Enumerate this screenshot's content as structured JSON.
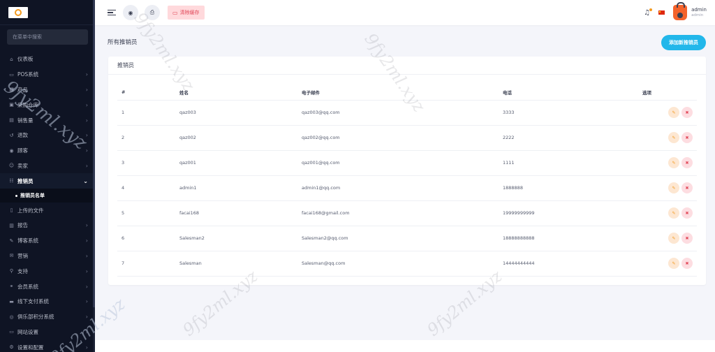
{
  "sidebar": {
    "search_placeholder": "在菜单中搜索",
    "items": [
      {
        "label": "仪表板",
        "icon": "home-icon",
        "glyph": "⌂",
        "chevron": false
      },
      {
        "label": "POS系统",
        "icon": "pos-icon",
        "glyph": "▭",
        "chevron": true
      },
      {
        "label": "产品",
        "icon": "product-icon",
        "glyph": "▦",
        "chevron": true
      },
      {
        "label": "采购仓库",
        "icon": "purchase-icon",
        "glyph": "▣",
        "chevron": true
      },
      {
        "label": "销售量",
        "icon": "sales-icon",
        "glyph": "▤",
        "chevron": true
      },
      {
        "label": "退款",
        "icon": "refund-icon",
        "glyph": "↺",
        "chevron": true
      },
      {
        "label": "顾客",
        "icon": "customer-icon",
        "glyph": "◉",
        "chevron": true
      },
      {
        "label": "卖家",
        "icon": "seller-icon",
        "glyph": "☺",
        "chevron": true
      },
      {
        "label": "推销员",
        "icon": "salesman-icon",
        "glyph": "☷",
        "chevron": true,
        "active": true
      },
      {
        "label": "上传的文件",
        "icon": "file-icon",
        "glyph": "▯",
        "chevron": false
      },
      {
        "label": "报告",
        "icon": "report-icon",
        "glyph": "▥",
        "chevron": true
      },
      {
        "label": "博客系统",
        "icon": "blog-icon",
        "glyph": "✎",
        "chevron": true
      },
      {
        "label": "营销",
        "icon": "marketing-icon",
        "glyph": "✉",
        "chevron": true
      },
      {
        "label": "支持",
        "icon": "support-icon",
        "glyph": "⚲",
        "chevron": true
      },
      {
        "label": "会员系统",
        "icon": "member-icon",
        "glyph": "⚭",
        "chevron": true
      },
      {
        "label": "线下支付系统",
        "icon": "offline-pay-icon",
        "glyph": "▬",
        "chevron": true
      },
      {
        "label": "俱乐部积分系统",
        "icon": "club-point-icon",
        "glyph": "◎",
        "chevron": true
      },
      {
        "label": "网站设置",
        "icon": "website-icon",
        "glyph": "▭",
        "chevron": true
      },
      {
        "label": "设置和配置",
        "icon": "settings-icon",
        "glyph": "⚙",
        "chevron": true
      }
    ],
    "sub_item": "推销员名单"
  },
  "topbar": {
    "clear_cache_label": "清除缓存",
    "user_name": "admin",
    "user_role": "admin"
  },
  "page": {
    "title": "所有推销员",
    "add_button": "添加新推销员",
    "card_title": "推销员"
  },
  "table": {
    "headers": [
      "#",
      "姓名",
      "电子邮件",
      "电话",
      "选项"
    ],
    "rows": [
      {
        "num": "1",
        "name": "qaz003",
        "email": "qaz003@qq.com",
        "phone": "3333"
      },
      {
        "num": "2",
        "name": "qaz002",
        "email": "qaz002@qq.com",
        "phone": "2222"
      },
      {
        "num": "3",
        "name": "qaz001",
        "email": "qaz001@qq.com",
        "phone": "1111"
      },
      {
        "num": "4",
        "name": "admin1",
        "email": "admin1@qq.com",
        "phone": "1888888"
      },
      {
        "num": "5",
        "name": "facai168",
        "email": "facai168@gmail.com",
        "phone": "19999999999"
      },
      {
        "num": "6",
        "name": "Salesman2",
        "email": "Salesman2@qq.com",
        "phone": "18888888888"
      },
      {
        "num": "7",
        "name": "Salesman",
        "email": "Salesman@qq.com",
        "phone": "14444444444"
      }
    ]
  },
  "watermark_text": "9fy2ml.xyz",
  "colors": {
    "sidebar_bg": "#0f1424",
    "accent": "#22b7ea",
    "danger": "#e14758",
    "warning": "#f39a1e"
  }
}
